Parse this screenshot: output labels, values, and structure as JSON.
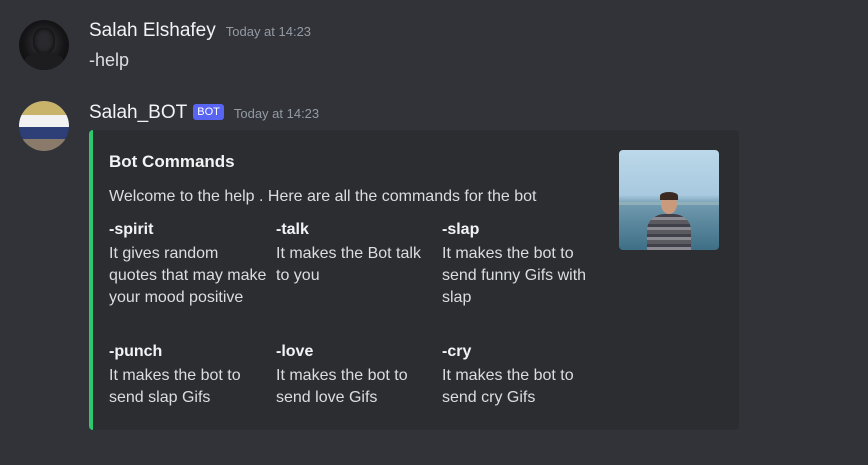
{
  "messages": [
    {
      "username": "Salah Elshafey",
      "timestamp": "Today at 14:23",
      "content": "-help"
    },
    {
      "username": "Salah_BOT",
      "badge": "BOT",
      "timestamp": "Today at 14:23",
      "embed": {
        "accent_color": "#2dc770",
        "title": "Bot Commands",
        "description": "Welcome to the help . Here are all the commands for the bot",
        "fields": [
          {
            "name": "-spirit",
            "value": "It gives random quotes that may make your mood positive"
          },
          {
            "name": "-talk",
            "value": "It makes the Bot talk to you"
          },
          {
            "name": "-slap",
            "value": "It makes the bot to send funny Gifs with slap"
          },
          {
            "name": "-punch",
            "value": "It makes the bot to send slap Gifs"
          },
          {
            "name": "-love",
            "value": "It makes the bot to send love Gifs"
          },
          {
            "name": "-cry",
            "value": "It makes the bot to send cry Gifs"
          }
        ],
        "thumbnail": "profile-photo"
      }
    }
  ],
  "colors": {
    "background": "#313338",
    "embed_background": "#2b2d31",
    "bot_badge": "#5865f2",
    "timestamp": "#949ba4"
  }
}
